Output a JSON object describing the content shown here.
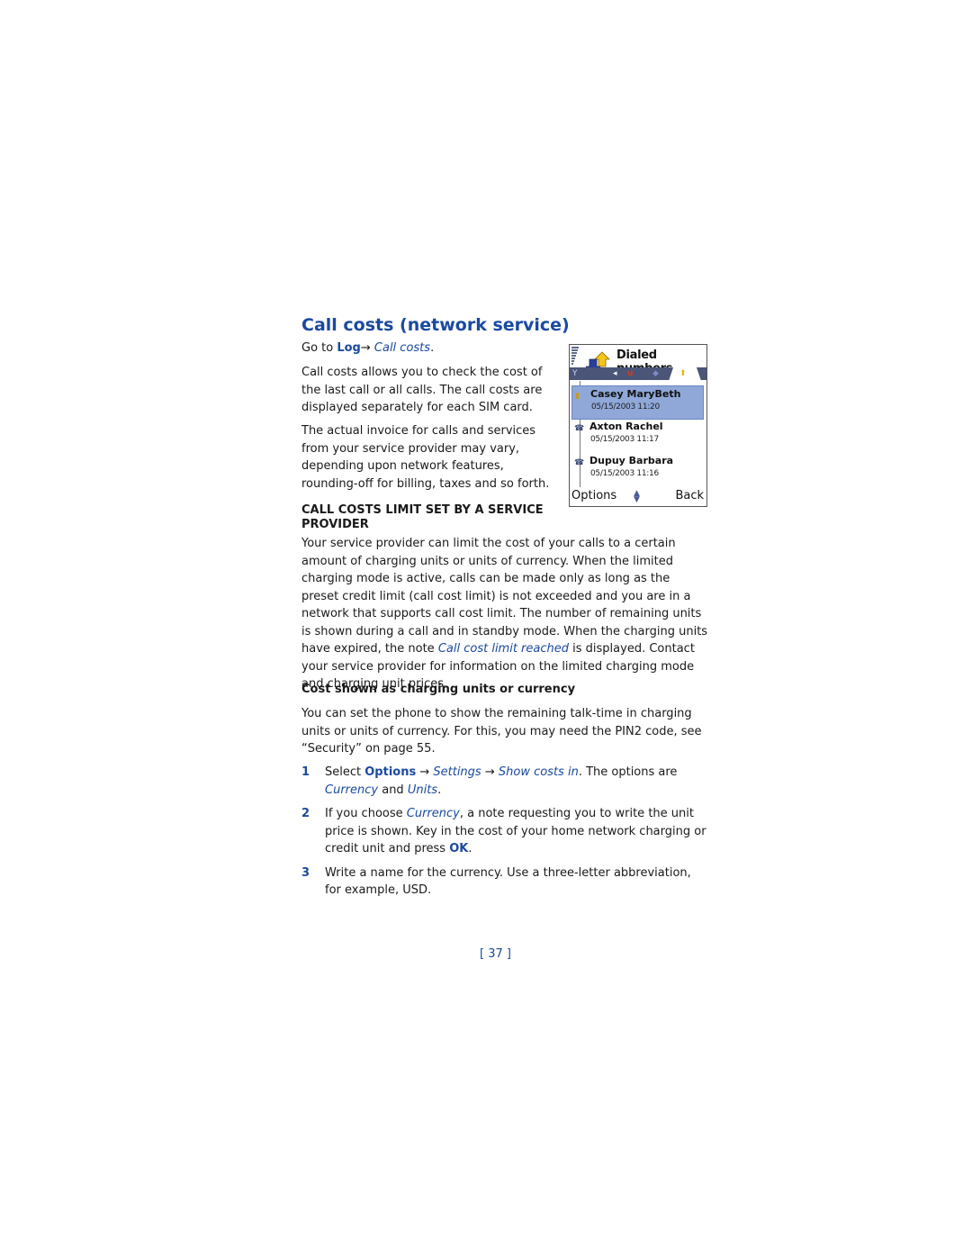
{
  "heading": "Call costs (network service)",
  "goto": {
    "prefix": "Go to ",
    "menu": "Log",
    "arrow": "→ ",
    "item": "Call costs",
    "suffix": "."
  },
  "intro": "Call costs allows you to check the cost of the last call or all calls. The call costs are displayed separately for each SIM card.",
  "invoice": "The actual invoice for calls and services from your service provider may vary, depending upon network features, rounding-off for billing, taxes and so forth.",
  "limit_section": {
    "heading": "CALL COSTS LIMIT SET BY A SERVICE PROVIDER",
    "body_before": "Your service provider can limit the cost of your calls to a certain amount of charging units or units of currency. When the limited charging mode is active, calls can be made only as long as the preset credit limit (call cost limit) is not exceeded and you are in a network that supports call cost limit. The number of remaining units is shown during a call and in standby mode. When the charging units have expired, the note ",
    "note": "Call cost limit reached",
    "body_after": " is displayed. Contact your service provider for information on the limited charging mode and charging unit prices."
  },
  "cost_section": {
    "heading": "Cost shown as charging units or currency",
    "body": "You can set the phone to show the remaining talk-time in charging units or units of currency. For this, you may need the PIN2 code, see “Security” on page 55."
  },
  "steps": [
    {
      "num": "1",
      "t1": "Select ",
      "b1": "Options",
      "t2": " → ",
      "i1": "Settings",
      "t3": " → ",
      "i2": "Show costs in",
      "t4": ". The options are ",
      "i3": "Currency",
      "t5": " and ",
      "i4": "Units",
      "t6": "."
    },
    {
      "num": "2",
      "t1": "If you choose ",
      "i1": "Currency",
      "t2": ", a note requesting you to write the unit price is shown. Key in the cost of your home network charging or credit unit and press ",
      "b1": "OK",
      "t3": "."
    },
    {
      "num": "3",
      "t1": "Write a name for the currency. Use a three-letter abbreviation, for example, USD."
    }
  ],
  "page_number": "[ 37 ]",
  "phone_screen": {
    "title": "Dialed numbers",
    "title_icon": "dialed-calls-icon",
    "tabs": [
      "missed-calls-tab",
      "received-calls-tab",
      "dialed-calls-tab"
    ],
    "entries": [
      {
        "name": "Casey MaryBeth",
        "datetime": "05/15/2003 11:20",
        "icon": "sim-contact-icon",
        "selected": true
      },
      {
        "name": "Axton Rachel",
        "datetime": "05/15/2003 11:17",
        "icon": "phone-icon",
        "selected": false
      },
      {
        "name": "Dupuy Barbara",
        "datetime": "05/15/2003 11:16",
        "icon": "phone-icon",
        "selected": false
      }
    ],
    "softkeys": {
      "left": "Options",
      "right": "Back"
    }
  }
}
